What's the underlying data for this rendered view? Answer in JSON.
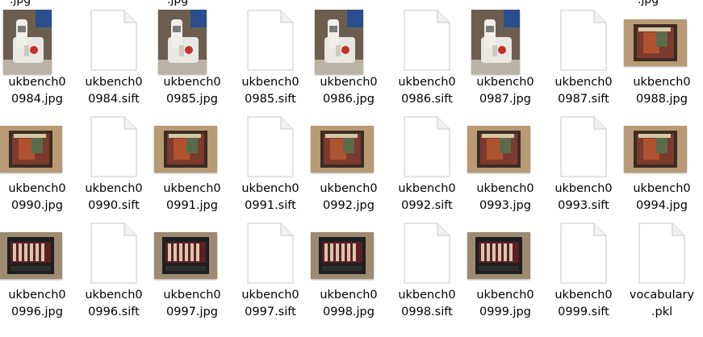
{
  "top_cut_labels": [
    ".jpg",
    ".jpg",
    ".jpg"
  ],
  "files": [
    {
      "line1": "ukbench0",
      "line2": "0984.jpg",
      "kind": "phone"
    },
    {
      "line1": "ukbench0",
      "line2": "0984.sift",
      "kind": "doc"
    },
    {
      "line1": "ukbench0",
      "line2": "0985.jpg",
      "kind": "phone"
    },
    {
      "line1": "ukbench0",
      "line2": "0985.sift",
      "kind": "doc"
    },
    {
      "line1": "ukbench0",
      "line2": "0986.jpg",
      "kind": "phone"
    },
    {
      "line1": "ukbench0",
      "line2": "0986.sift",
      "kind": "doc"
    },
    {
      "line1": "ukbench0",
      "line2": "0987.jpg",
      "kind": "phone"
    },
    {
      "line1": "ukbench0",
      "line2": "0987.sift",
      "kind": "doc"
    },
    {
      "line1": "ukbench0",
      "line2": "0988.jpg",
      "kind": "cd-red"
    },
    {
      "line1": "ukbench0",
      "line2": "0990.jpg",
      "kind": "cd-red"
    },
    {
      "line1": "ukbench0",
      "line2": "0990.sift",
      "kind": "doc"
    },
    {
      "line1": "ukbench0",
      "line2": "0991.jpg",
      "kind": "cd-red"
    },
    {
      "line1": "ukbench0",
      "line2": "0991.sift",
      "kind": "doc"
    },
    {
      "line1": "ukbench0",
      "line2": "0992.jpg",
      "kind": "cd-red"
    },
    {
      "line1": "ukbench0",
      "line2": "0992.sift",
      "kind": "doc"
    },
    {
      "line1": "ukbench0",
      "line2": "0993.jpg",
      "kind": "cd-red"
    },
    {
      "line1": "ukbench0",
      "line2": "0993.sift",
      "kind": "doc"
    },
    {
      "line1": "ukbench0",
      "line2": "0994.jpg",
      "kind": "cd-red"
    },
    {
      "line1": "ukbench0",
      "line2": "0996.jpg",
      "kind": "cd-dark"
    },
    {
      "line1": "ukbench0",
      "line2": "0996.sift",
      "kind": "doc"
    },
    {
      "line1": "ukbench0",
      "line2": "0997.jpg",
      "kind": "cd-dark"
    },
    {
      "line1": "ukbench0",
      "line2": "0997.sift",
      "kind": "doc"
    },
    {
      "line1": "ukbench0",
      "line2": "0998.jpg",
      "kind": "cd-dark"
    },
    {
      "line1": "ukbench0",
      "line2": "0998.sift",
      "kind": "doc"
    },
    {
      "line1": "ukbench0",
      "line2": "0999.jpg",
      "kind": "cd-dark"
    },
    {
      "line1": "ukbench0",
      "line2": "0999.sift",
      "kind": "doc"
    },
    {
      "line1": "vocabulary",
      "line2": ".pkl",
      "kind": "doc"
    }
  ]
}
